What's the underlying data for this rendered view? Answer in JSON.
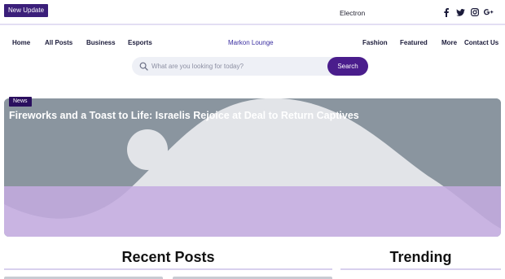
{
  "topbar": {
    "badge": "New Update",
    "ticker_text": "Electron",
    "social": [
      {
        "icon": "facebook-icon"
      },
      {
        "icon": "twitter-icon"
      },
      {
        "icon": "instagram-icon"
      },
      {
        "icon": "google-plus-icon"
      }
    ]
  },
  "nav": {
    "home": "Home",
    "all_posts": "All Posts",
    "business": "Business",
    "esports": "Esports",
    "brand": "Markon Lounge",
    "fashion": "Fashion",
    "featured": "Featured",
    "more": "More",
    "contact": "Contact Us"
  },
  "search": {
    "placeholder": "What are you looking for today?",
    "button_label": "Search"
  },
  "hero": {
    "category": "News",
    "title": "Fireworks and a Toast to Life: Israelis Rejoice at Deal to Return Captives"
  },
  "sections": {
    "recent": "Recent Posts",
    "trending": "Trending"
  },
  "colors": {
    "accent": "#4a1d8c",
    "badge": "#3b1f7a",
    "brand_link": "#3a2ea0",
    "hero_overlay": "#c4ace1"
  }
}
